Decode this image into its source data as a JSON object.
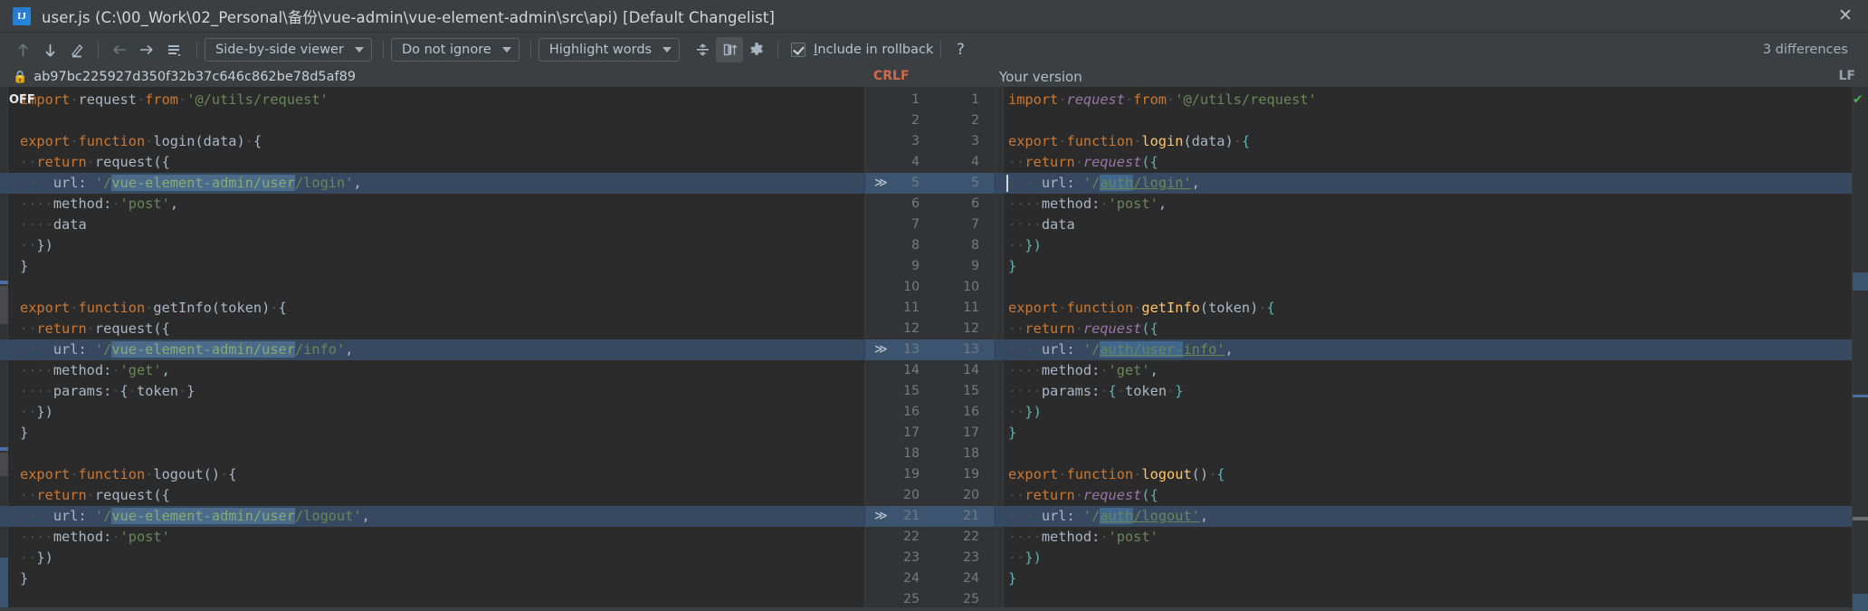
{
  "window": {
    "title": "user.js (C:\\00_Work\\02_Personal\\备份\\vue-admin\\vue-element-admin\\src\\api) [Default Changelist]",
    "logo_text": "IJ",
    "close_label": "✕"
  },
  "toolbar": {
    "icons": [
      {
        "name": "previous-difference-icon",
        "glyph": "↑"
      },
      {
        "name": "next-difference-icon",
        "glyph": "↓"
      },
      {
        "name": "annotate-icon",
        "glyph": "✎"
      },
      {
        "name": "accept-left-icon",
        "glyph": "←"
      },
      {
        "name": "accept-right-icon",
        "glyph": "→"
      },
      {
        "name": "show-diff-list-icon",
        "glyph": "≡"
      }
    ],
    "viewer_mode": "Side-by-side viewer",
    "whitespace_mode": "Do not ignore",
    "highlight_mode": "Highlight words",
    "collapse_icon": "collapse-unchanged-icon",
    "sync_scroll_icon": "synchronize-scroll-icon",
    "settings_icon": "gear-icon",
    "include_in_rollback": "Include in rollback",
    "include_mnemonic": "I",
    "include_rest": "nclude in rollback",
    "help_label": "?",
    "differences_count": "3 differences"
  },
  "subheader": {
    "revision_hash": "ab97bc225927d350f32b37c646c862be78d5af89",
    "lock_icon": "lock-icon",
    "left_line_separator": "CRLF",
    "right_title": "Your version",
    "right_line_separator": "LF"
  },
  "editor": {
    "off_badge": "OFF",
    "left_line_numbers": [
      1,
      2,
      3,
      4,
      5,
      6,
      7,
      8,
      9,
      10,
      11,
      12,
      13,
      14,
      15,
      16,
      17,
      18,
      19,
      20,
      21,
      22,
      23,
      24,
      25
    ],
    "right_line_numbers": [
      1,
      2,
      3,
      4,
      5,
      6,
      7,
      8,
      9,
      10,
      11,
      12,
      13,
      14,
      15,
      16,
      17,
      18,
      19,
      20,
      21,
      22,
      23,
      24,
      25
    ],
    "changed_lines": [
      5,
      13,
      21
    ],
    "chevron_glyph": "≫",
    "ok_check": "✔"
  },
  "left_code": [
    "import request from '@/utils/request'",
    "",
    "export function login(data) {",
    "  return request({",
    "    url: '/vue-element-admin/user/login',",
    "    method: 'post',",
    "    data",
    "  })",
    "}",
    "",
    "export function getInfo(token) {",
    "  return request({",
    "    url: '/vue-element-admin/user/info',",
    "    method: 'get',",
    "    params: { token }",
    "  })",
    "}",
    "",
    "export function logout() {",
    "  return request({",
    "    url: '/vue-element-admin/user/logout',",
    "    method: 'post'",
    "  })",
    "}"
  ],
  "right_code": [
    "import request from '@/utils/request'",
    "",
    "export function login(data) {",
    "  return request({",
    "    url: '/auth/login',",
    "    method: 'post',",
    "    data",
    "  })",
    "}",
    "",
    "export function getInfo(token) {",
    "  return request({",
    "    url: '/auth/user-info',",
    "    method: 'get',",
    "    params: { token }",
    "  })",
    "}",
    "",
    "export function logout() {",
    "  return request({",
    "    url: '/auth/logout',",
    "    method: 'post'",
    "  })",
    "}"
  ],
  "colors": {
    "background": "#2b2b2b",
    "chrome": "#3c3f41",
    "gutter": "#313335",
    "keyword": "#cc7832",
    "string": "#6a8759",
    "function": "#ffc66d",
    "variable": "#9876aa",
    "diff_highlight": "#364961",
    "word_highlight": "#41678c",
    "crlf": "#cf6a4c",
    "ok_green": "#4caf50"
  }
}
